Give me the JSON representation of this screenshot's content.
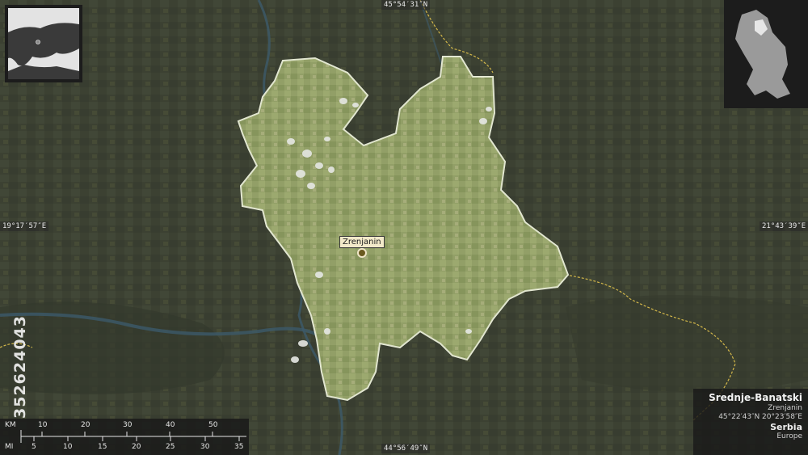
{
  "coordinates": {
    "top": "45°54′31″N",
    "bottom": "44°56′49″N",
    "left": "19°17′57″E",
    "right": "21°43′39″E"
  },
  "region": {
    "name": "Srednje-Banatski",
    "capital": "Zrenjanin",
    "center_coords": "45°22′43″N 20°23′58″E",
    "country": "Serbia",
    "continent": "Europe"
  },
  "city_label": "Zrenjanin",
  "scale_bar": {
    "km_label": "KM",
    "mi_label": "MI",
    "km_ticks": [
      "10",
      "20",
      "30",
      "40",
      "50"
    ],
    "mi_ticks": [
      "5",
      "10",
      "15",
      "20",
      "25",
      "30",
      "35"
    ]
  },
  "watermark": "352624043",
  "colors": {
    "region_fill": "#8a9a5e",
    "region_outline": "#e8ecd8",
    "border_line": "#d4b84a",
    "river": "#3c5a6a"
  }
}
